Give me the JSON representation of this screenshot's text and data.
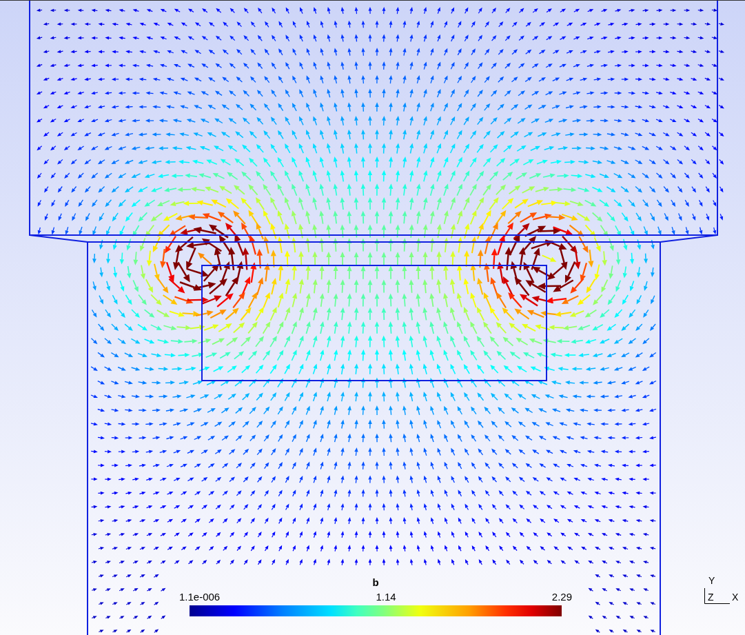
{
  "legend": {
    "title": "b",
    "min_label": "1.1e-006",
    "mid_label": "1.14",
    "max_label": "2.29"
  },
  "axes_triad": {
    "y": "Y",
    "z": "Z",
    "x": "X"
  }
}
